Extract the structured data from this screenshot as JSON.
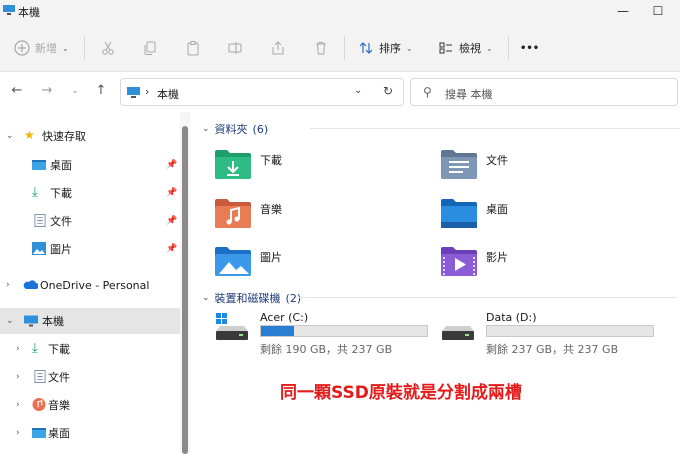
{
  "window": {
    "title": "本機",
    "minimize": "—",
    "maximize": "☐"
  },
  "toolbar": {
    "new_label": "新增",
    "sort_label": "排序",
    "view_label": "檢視",
    "more": "•••"
  },
  "address": {
    "crumb_separator": "›",
    "crumb": "本機",
    "search_placeholder": "搜尋 本機"
  },
  "nav": {
    "quick_access": "快速存取",
    "pinned": [
      {
        "label": "桌面",
        "icon": "desktop-icon"
      },
      {
        "label": "下載",
        "icon": "download-icon"
      },
      {
        "label": "文件",
        "icon": "documents-icon"
      },
      {
        "label": "圖片",
        "icon": "pictures-icon"
      }
    ],
    "onedrive": "OneDrive - Personal",
    "this_pc": "本機",
    "this_pc_children": [
      {
        "label": "下載",
        "icon": "download-icon"
      },
      {
        "label": "文件",
        "icon": "documents-icon"
      },
      {
        "label": "音樂",
        "icon": "music-icon"
      },
      {
        "label": "桌面",
        "icon": "desktop-icon"
      }
    ]
  },
  "folders_group": {
    "title": "資料夾",
    "count": "(6)",
    "items": [
      {
        "label": "下載",
        "icon": "downloads-folder-icon"
      },
      {
        "label": "文件",
        "icon": "documents-folder-icon"
      },
      {
        "label": "音樂",
        "icon": "music-folder-icon"
      },
      {
        "label": "桌面",
        "icon": "desktop-folder-icon"
      },
      {
        "label": "圖片",
        "icon": "pictures-folder-icon"
      },
      {
        "label": "影片",
        "icon": "videos-folder-icon"
      }
    ]
  },
  "drives_group": {
    "title": "裝置和磁碟機",
    "count": "(2)",
    "items": [
      {
        "name": "Acer (C:)",
        "info": "剩餘 190 GB，共 237 GB",
        "used_fraction": 0.2,
        "icon": "windows-drive-icon"
      },
      {
        "name": "Data (D:)",
        "info": "剩餘 237 GB，共 237 GB",
        "used_fraction": 0.0,
        "icon": "drive-icon"
      }
    ]
  },
  "annotation": "同一顆SSD原裝就是分割成兩槽",
  "colors": {
    "accent": "#2b7cd3",
    "annotation": "#e31b1b",
    "group_header": "#1f3b7a"
  }
}
